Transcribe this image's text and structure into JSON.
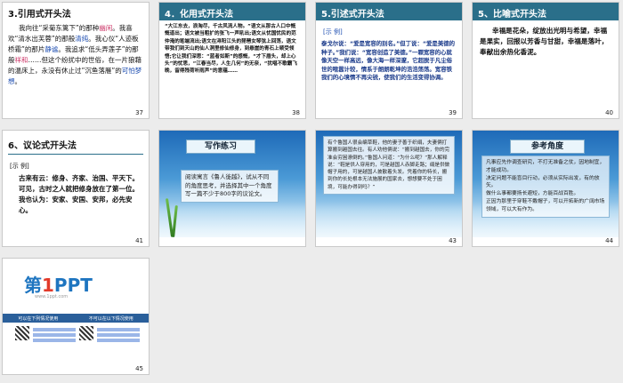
{
  "slides": {
    "s37": {
      "number": "37",
      "title": "3.引用式开头法",
      "body_parts": [
        "我向往“采菊东篱下”的那种",
        "幽闲",
        "。我喜欢“清水出芙蓉”的那般",
        "清纯",
        "。我心仪“人迹板桥霜”的那片",
        "静谧",
        "。我追求“低头弄莲子”的那般",
        "祥和",
        "……但这个纷扰中的世俗，在一片狼藉的温床上，永没有休止过”沉鱼落雁”的",
        "可怕梦想",
        "。"
      ]
    },
    "s38": {
      "number": "38",
      "title": "4．化用式开头法",
      "body": "“大江东去，浪淘尽，千古风流人物。”语文从那古人口中慨慨道出；语文被当粗扩的张飞一声吼出;语文从忧国忧民的范仲淹的笔端流出;语文在浔阳江头的琵琶女琴弦上回荡，语文带我们到天山的仙人洞里修仙修身，到悬崖的青石上顿受领悟;它让我们深思：“蓝者如斯”的感慨，“才下眉头，却上心头”的忧思，“江春当尽，人生几何”的无奈，“犹唱不歌霸飞晚，留得残荷听雨声”的意蕴……"
    },
    "s39": {
      "number": "39",
      "title": "5.引述式开头法",
      "label": "[示 例]",
      "body": "泰戈尔说：“爱是宽容的别名。”但丁说：“爱是美德的种子。”我们说：“宽容创造了美德。”一颗宽容的心就像天空一样高远，像大海一样深邃，它超脱于凡尘俗世的喧嚣计较，情系于朗朗乾坤的浩浩荡荡。宽容铁我们的心境情不再尖锐，使我们的生活变得协调。"
    },
    "s40": {
      "number": "40",
      "title": "5、比喻式开头法",
      "body": "幸福是花朵，绽放出光明与希望，幸福是果实，回报以芳香与甘甜，幸福是落叶，奉献出余热化香泥。"
    },
    "s41": {
      "number": "41",
      "title": "6、议论式开头法",
      "label": "[示 例]",
      "body": "古来有云：修身、齐家、治国、平天下。可见，古时之人就把修身放在了第一位。我也认为：安家、安国、安邦，必先安心。"
    },
    "s42": {
      "number": "42",
      "title": "写作练习",
      "body": "阅读寓言《鲁人徙越》，试从不同的角度思考，并选择其中一个角度写一篇不少于800字的议论文。"
    },
    "s43": {
      "number": "43",
      "body": "有个鲁国人很会编草鞋，他的妻子善于织绢，夫妻俩打算搬到越国去往。有人劝他俩说：“搬到越国去，你的完准会穷困潦倒的。”鲁国人问道：“为什么呢？”那人解释说：“鞋是供人穿用的，可是越国人赤脚走路；绢是供做帽子用的，可是越国人披散着头发。凭着你的特长，搬到你的长处根本无法施展的国家去，想想要不处于困境，可能办得到吗？”"
    },
    "s44": {
      "number": "44",
      "title": "参考角度",
      "body": "凡事应先作调查研究，不打无准备之仗，因地制宜，才能成功。\n决定问题不能盲目行动，必须从实际出发，有的放矢。\n做什么事都要扬长避短，方能百战百胜。\n正因为那里于穿鞋不戴帽子，可以开拓新的广阔市场领域，可以大有作为。"
    },
    "s45": {
      "number": "45",
      "logo_main": "第",
      "logo_num": "1",
      "logo_tail": "PPT",
      "logo_sub": "www.1ppt.com",
      "bar_left": "可以在下列情况使用",
      "bar_right": "不可以在以下情况使用"
    }
  },
  "colors": {
    "header_teal": "#2a6f8a",
    "highlight_blue": "#1a4bb0",
    "ocean_top": "#1e6ab8"
  }
}
